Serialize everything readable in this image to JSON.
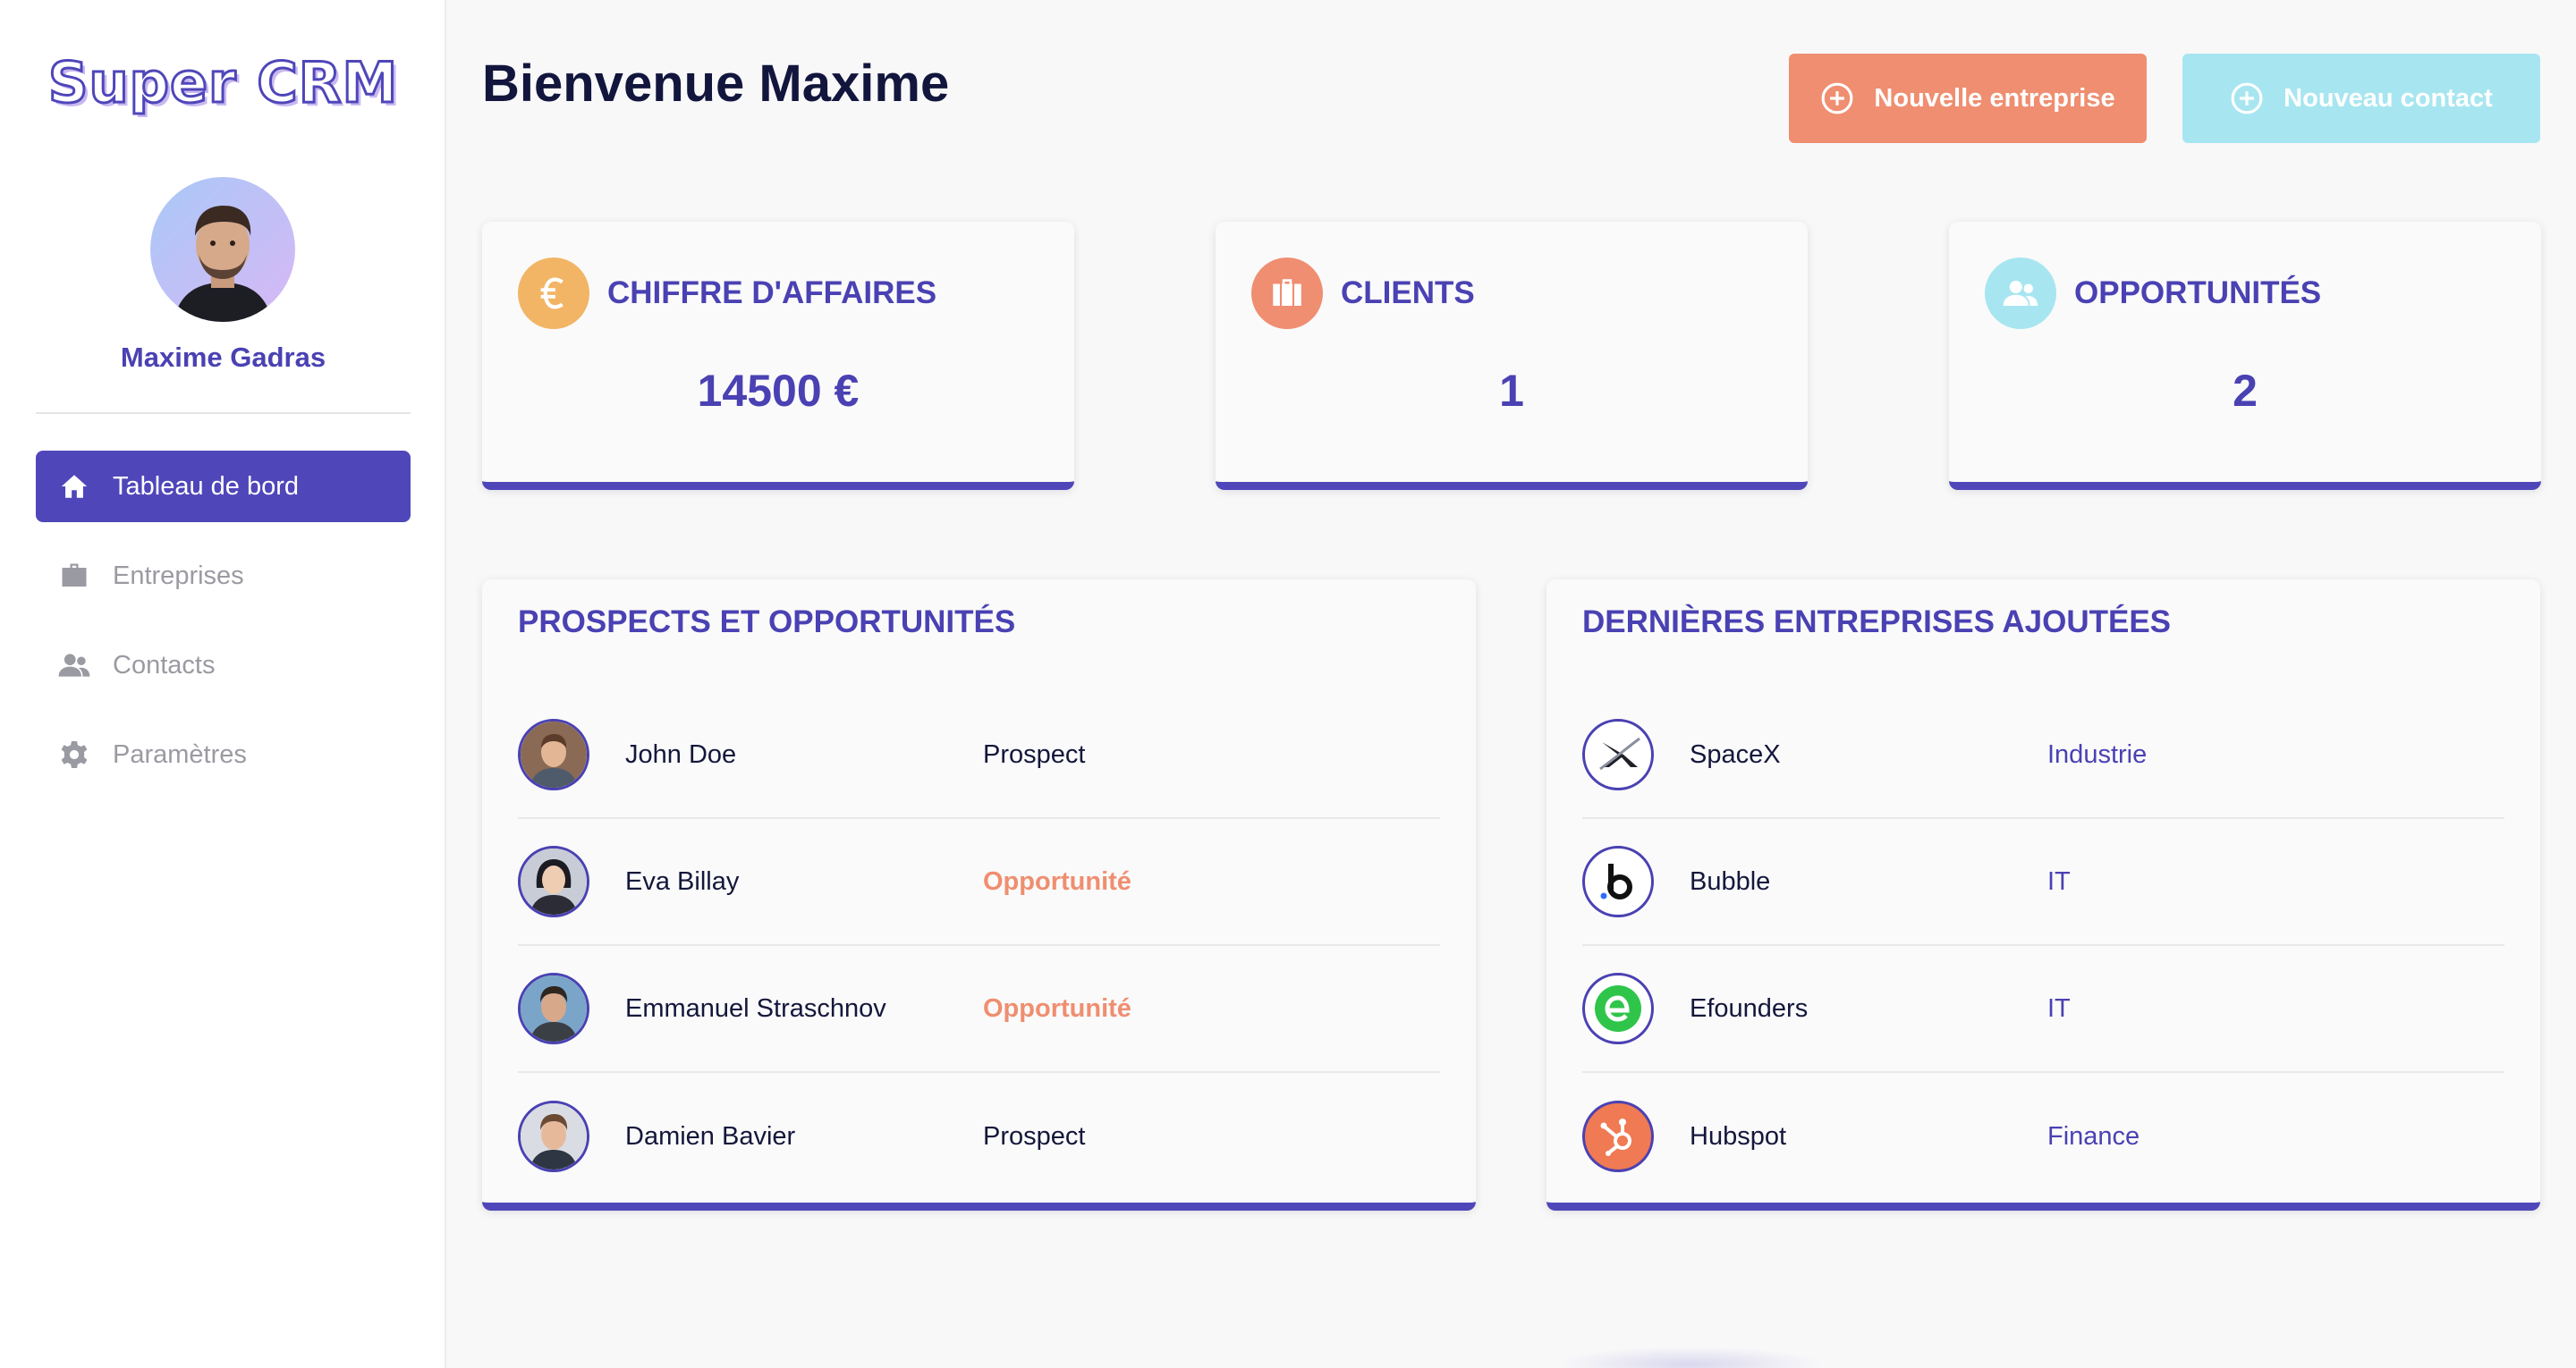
{
  "app": {
    "logo": "Super CRM"
  },
  "user": {
    "name": "Maxime Gadras"
  },
  "nav": {
    "items": [
      {
        "label": "Tableau de bord",
        "icon": "home-icon",
        "active": true
      },
      {
        "label": "Entreprises",
        "icon": "briefcase-icon",
        "active": false
      },
      {
        "label": "Contacts",
        "icon": "people-icon",
        "active": false
      },
      {
        "label": "Paramètres",
        "icon": "gear-icon",
        "active": false
      }
    ]
  },
  "header": {
    "title": "Bienvenue Maxime",
    "new_company_label": "Nouvelle entreprise",
    "new_contact_label": "Nouveau contact"
  },
  "stats": [
    {
      "label": "CHIFFRE D'AFFAIRES",
      "value": "14500 €",
      "icon": "euro-icon",
      "color": "#f2b565"
    },
    {
      "label": "CLIENTS",
      "value": "1",
      "icon": "briefcase-icon",
      "color": "#ef8e70"
    },
    {
      "label": "OPPORTUNITÉS",
      "value": "2",
      "icon": "people-icon",
      "color": "#a7e6f0"
    }
  ],
  "prospects": {
    "title": "PROSPECTS ET OPPORTUNITÉS",
    "rows": [
      {
        "name": "John Doe",
        "status": "Prospect",
        "type": "prospect"
      },
      {
        "name": "Eva Billay",
        "status": "Opportunité",
        "type": "opportunity"
      },
      {
        "name": "Emmanuel Straschnov",
        "status": "Opportunité",
        "type": "opportunity"
      },
      {
        "name": "Damien Bavier",
        "status": "Prospect",
        "type": "prospect"
      }
    ]
  },
  "companies": {
    "title": "DERNIÈRES ENTREPRISES AJOUTÉES",
    "rows": [
      {
        "name": "SpaceX",
        "sector": "Industrie",
        "logo": "spacex-logo"
      },
      {
        "name": "Bubble",
        "sector": "IT",
        "logo": "bubble-logo"
      },
      {
        "name": "Efounders",
        "sector": "IT",
        "logo": "efounders-logo"
      },
      {
        "name": "Hubspot",
        "sector": "Finance",
        "logo": "hubspot-logo"
      }
    ]
  },
  "colors": {
    "primary": "#4f46ba",
    "accent_orange": "#ef8e70",
    "accent_cyan": "#a7e6f0",
    "accent_yellow": "#f2b565"
  }
}
